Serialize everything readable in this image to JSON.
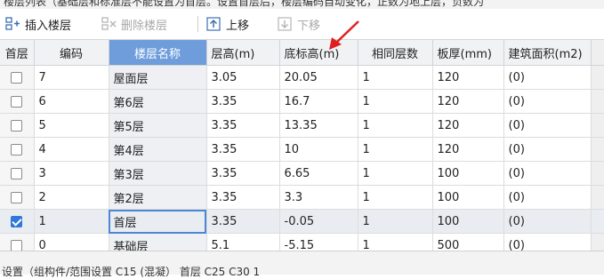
{
  "top_note": "楼层列表（基础层和标准层不能设置为首层。设置首层后，楼层编码自动变化，正数为地上层，负数为",
  "toolbar": {
    "insert_label": "插入楼层",
    "delete_label": "删除楼层",
    "up_label": "上移",
    "down_label": "下移"
  },
  "columns": [
    "首层",
    "编码",
    "楼层名称",
    "层高(m)",
    "底标高(m)",
    "相同层数",
    "板厚(mm)",
    "建筑面积(m2)"
  ],
  "rows": [
    {
      "first": false,
      "code": "7",
      "name": "屋面层",
      "height": "3.05",
      "elev": "20.05",
      "same": "1",
      "slab": "120",
      "area": "(0)"
    },
    {
      "first": false,
      "code": "6",
      "name": "第6层",
      "height": "3.35",
      "elev": "16.7",
      "same": "1",
      "slab": "120",
      "area": "(0)"
    },
    {
      "first": false,
      "code": "5",
      "name": "第5层",
      "height": "3.35",
      "elev": "13.35",
      "same": "1",
      "slab": "120",
      "area": "(0)"
    },
    {
      "first": false,
      "code": "4",
      "name": "第4层",
      "height": "3.35",
      "elev": "10",
      "same": "1",
      "slab": "120",
      "area": "(0)"
    },
    {
      "first": false,
      "code": "3",
      "name": "第3层",
      "height": "3.35",
      "elev": "6.65",
      "same": "1",
      "slab": "100",
      "area": "(0)"
    },
    {
      "first": false,
      "code": "2",
      "name": "第2层",
      "height": "3.35",
      "elev": "3.3",
      "same": "1",
      "slab": "100",
      "area": "(0)"
    },
    {
      "first": true,
      "code": "1",
      "name": "首层",
      "height": "3.35",
      "elev": "-0.05",
      "same": "1",
      "slab": "100",
      "area": "(0)"
    },
    {
      "first": false,
      "code": "0",
      "name": "基础层",
      "height": "5.1",
      "elev": "-5.15",
      "same": "1",
      "slab": "500",
      "area": "(0)"
    }
  ],
  "bottom_note": "设置（组构件/范围设置 C15 (混凝） 首层 C25 C30  1"
}
